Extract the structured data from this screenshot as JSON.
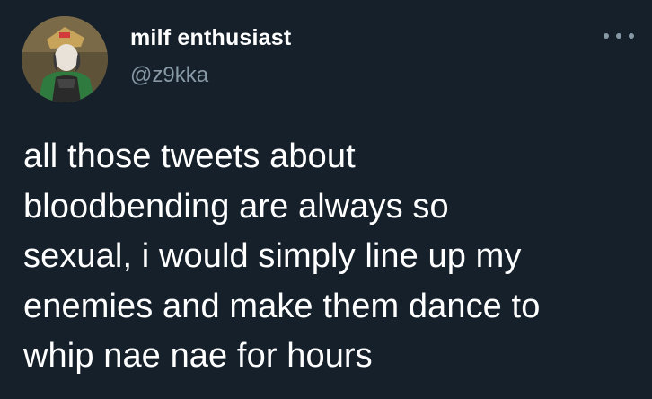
{
  "tweet": {
    "author": {
      "display_name": "milf enthusiast",
      "handle": "@z9kka",
      "avatar_icon": "avatar-anime-character"
    },
    "more_icon": "ellipsis-icon",
    "text": "all those tweets about\nbloodbending are always so\nsexual, i would simply line up my\nenemies and make them dance to\nwhip nae nae for hours"
  },
  "colors": {
    "background": "#15202b",
    "primary_text": "#ffffff",
    "secondary_text": "#8899a6"
  }
}
